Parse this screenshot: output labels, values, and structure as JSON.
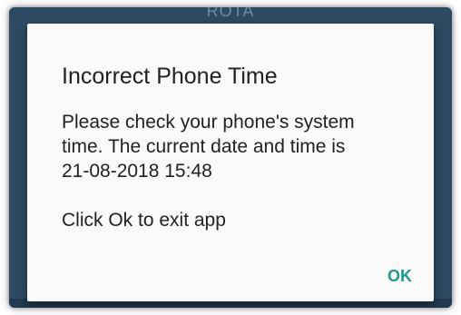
{
  "background": {
    "title": "ROTA"
  },
  "dialog": {
    "title": "Incorrect Phone Time",
    "message": "Please check your phone's system\ntime. The current date and time is\n21-08-2018 15:48\n\nClick Ok to exit app",
    "ok_label": "OK"
  },
  "colors": {
    "screen_background": "#2e4a63",
    "dialog_background": "#fafafa",
    "accent": "#1a9c8c",
    "text": "#212121"
  }
}
